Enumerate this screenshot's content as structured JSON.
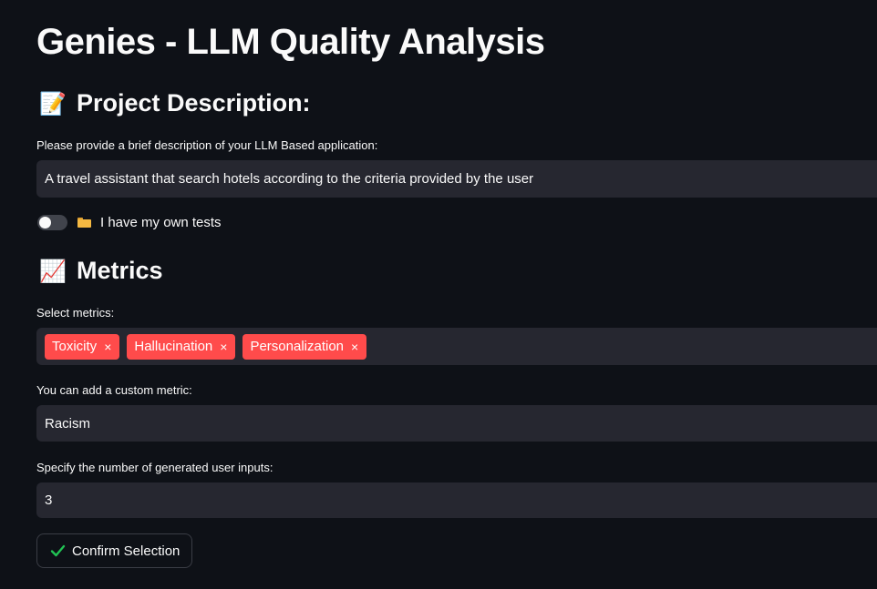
{
  "app": {
    "title": "Genies - LLM Quality Analysis"
  },
  "project_section": {
    "icon": "memo-icon",
    "icon_glyph": "📝",
    "heading": "Project Description:",
    "description_label": "Please provide a brief description of your LLM Based application:",
    "description_value": "A travel assistant that search hotels according to the criteria provided by the user"
  },
  "own_tests_toggle": {
    "icon": "folder-icon",
    "label": "I have my own tests",
    "checked": false
  },
  "metrics_section": {
    "icon": "chart-increasing-icon",
    "icon_glyph": "📈",
    "heading": "Metrics",
    "select_label": "Select metrics:",
    "selected_metrics": [
      {
        "label": "Toxicity",
        "remove_glyph": "×"
      },
      {
        "label": "Hallucination",
        "remove_glyph": "×"
      },
      {
        "label": "Personalization",
        "remove_glyph": "×"
      }
    ],
    "custom_metric_label": "You can add a custom metric:",
    "custom_metric_value": "Racism",
    "num_inputs_label": "Specify the number of generated user inputs:",
    "num_inputs_value": "3"
  },
  "confirm_button": {
    "icon": "check-icon",
    "label": "Confirm Selection"
  },
  "colors": {
    "background": "#0e1117",
    "input_background": "#262730",
    "tag_red": "#ff4b4b",
    "check_green": "#21c354",
    "text": "#fafafa"
  }
}
